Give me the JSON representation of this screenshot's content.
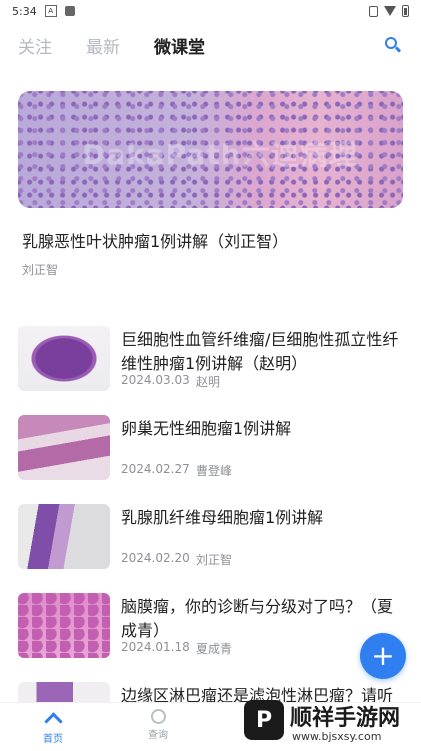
{
  "status_bar": {
    "time": "5:34",
    "notification_icon": "A"
  },
  "top_nav": {
    "tabs": [
      {
        "label": "关注",
        "active": false
      },
      {
        "label": "最新",
        "active": false
      },
      {
        "label": "微课堂",
        "active": true
      }
    ],
    "search_icon": "search-icon"
  },
  "featured": {
    "title": "乳腺恶性叶状肿瘤1例讲解（刘正智）",
    "author": "刘正智",
    "image_watermark": "DakaPath六迪病理"
  },
  "items": [
    {
      "title": "巨细胞性血管纤维瘤/巨细胞性孤立性纤维性肿瘤1例讲解（赵明）",
      "date": "2024.03.03",
      "author": "赵明"
    },
    {
      "title": "卵巢无性细胞瘤1例讲解",
      "date": "2024.02.27",
      "author": "曹登峰"
    },
    {
      "title": "乳腺肌纤维母细胞瘤1例讲解",
      "date": "2024.02.20",
      "author": "刘正智"
    },
    {
      "title": "脑膜瘤，你的诊断与分级对了吗？（夏成青）",
      "date": "2024.01.18",
      "author": "夏成青"
    },
    {
      "title": "边缘区淋巴瘤还是滤泡性淋巴瘤？请听",
      "date": "",
      "author": ""
    }
  ],
  "fab": {
    "label": "+"
  },
  "bottom_nav": [
    {
      "label": "首页",
      "active": true
    },
    {
      "label": "查询",
      "active": false
    },
    {
      "label": "",
      "active": false
    }
  ],
  "overlay_watermark": {
    "logo": "P",
    "text": "顺祥手游网",
    "url": "www.bjsxsy.com"
  },
  "colors": {
    "accent": "#2f7ff0",
    "muted": "#8d9096",
    "tab_inactive": "#b5b9c0"
  }
}
